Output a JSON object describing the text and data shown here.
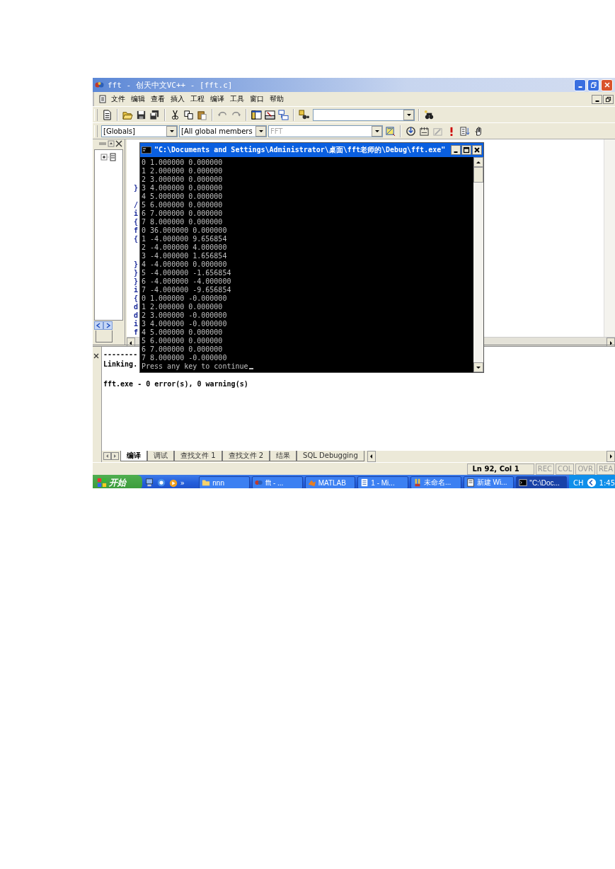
{
  "window": {
    "title": "fft - 创天中文VC++ - [fft.c]"
  },
  "menu": [
    "文件",
    "编辑",
    "查看",
    "插入",
    "工程",
    "编译",
    "工具",
    "窗口",
    "帮助"
  ],
  "wizard_bar": {
    "class_combo": "[Globals]",
    "members_combo": "[All global members",
    "function_combo": "FFT"
  },
  "editor": {
    "lines": [
      {
        "kind": "blank"
      },
      {
        "kind": "blank"
      },
      {
        "kind": "blank"
      },
      {
        "kind": "code",
        "text": "}"
      },
      {
        "kind": "blank"
      },
      {
        "kind": "code",
        "text": "/"
      },
      {
        "kind": "code",
        "text": "i"
      },
      {
        "kind": "code",
        "text": "{"
      },
      {
        "kind": "code",
        "text": "f"
      },
      {
        "kind": "code",
        "text": "{"
      },
      {
        "kind": "blank"
      },
      {
        "kind": "blank"
      },
      {
        "kind": "code",
        "text": "}"
      },
      {
        "kind": "code",
        "text": "}"
      },
      {
        "kind": "code",
        "text": "}"
      },
      {
        "kind": "code",
        "text": "i"
      },
      {
        "kind": "code",
        "text": "{"
      },
      {
        "kind": "code",
        "text": "d"
      },
      {
        "kind": "code",
        "text": "d"
      },
      {
        "kind": "code",
        "text": "i"
      },
      {
        "kind": "code",
        "text": "f"
      }
    ]
  },
  "console": {
    "title": "\"C:\\Documents and Settings\\Administrator\\桌面\\fft老师的\\Debug\\fft.exe\"",
    "lines": [
      "0 1.000000 0.000000",
      "1 2.000000 0.000000",
      "2 3.000000 0.000000",
      "3 4.000000 0.000000",
      "4 5.000000 0.000000",
      "5 6.000000 0.000000",
      "6 7.000000 0.000000",
      "7 8.000000 0.000000",
      "0 36.000000 0.000000",
      "1 -4.000000 9.656854",
      "2 -4.000000 4.000000",
      "3 -4.000000 1.656854",
      "4 -4.000000 0.000000",
      "5 -4.000000 -1.656854",
      "6 -4.000000 -4.000000",
      "7 -4.000000 -9.656854",
      "0 1.000000 -0.000000",
      "1 2.000000 0.000000",
      "2 3.000000 -0.000000",
      "3 4.000000 -0.000000",
      "4 5.000000 0.000000",
      "5 6.000000 0.000000",
      "6 7.000000 0.000000",
      "7 8.000000 -0.000000"
    ],
    "prompt": "Press any key to continue"
  },
  "output": {
    "lines": [
      {
        "kind": "text",
        "text": "--------"
      },
      {
        "kind": "text",
        "text": "Linking."
      },
      {
        "kind": "blank"
      },
      {
        "kind": "text",
        "text": "fft.exe - 0 error(s), 0 warning(s)"
      }
    ]
  },
  "output_tabs": [
    {
      "label": "编译",
      "selected": true
    },
    {
      "label": "调试",
      "selected": false
    },
    {
      "label": "查找文件 1",
      "selected": false
    },
    {
      "label": "查找文件 2",
      "selected": false
    },
    {
      "label": "结果",
      "selected": false
    },
    {
      "label": "SQL Debugging",
      "selected": false
    }
  ],
  "status_bar": {
    "position": "Ln 92, Col 1",
    "indicators": [
      "REC",
      "COL",
      "OVR",
      "REA"
    ]
  },
  "taskbar": {
    "start": "开始",
    "more": "»",
    "tasks": [
      {
        "label": "nnn",
        "kind": "folder",
        "selected": false
      },
      {
        "label": "fft - ...",
        "kind": "ide",
        "selected": false
      },
      {
        "label": "MATLAB",
        "kind": "matlab",
        "selected": false
      },
      {
        "label": "1 - Mi...",
        "kind": "document",
        "selected": false
      },
      {
        "label": "未命名...",
        "kind": "paint",
        "selected": false
      },
      {
        "label": "新建 Wi...",
        "kind": "notepad",
        "selected": false
      },
      {
        "label": "\"C:\\Doc...",
        "kind": "console",
        "selected": true
      }
    ],
    "language": "CH",
    "clock": "1:45"
  }
}
